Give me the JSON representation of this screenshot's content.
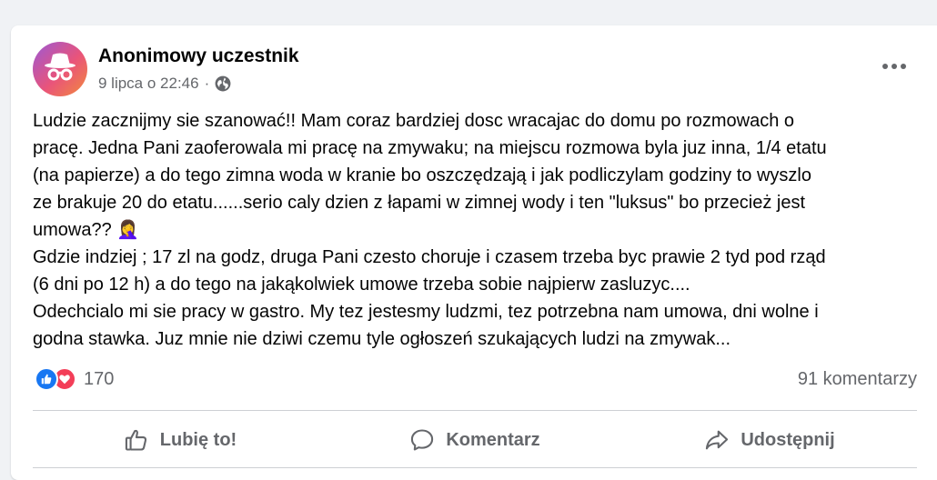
{
  "post": {
    "author": "Anonimowy uczestnik",
    "date": "9 lipca o 22:46",
    "separator": "·",
    "icons": {
      "avatar": "incognito-avatar-icon",
      "privacy": "globe-icon",
      "more": "more-options-icon"
    },
    "avatar_gradient": [
      "#9b59d6",
      "#e9547a",
      "#f28a3c"
    ],
    "text_lines": [
      "Ludzie zacznijmy sie szanować!!  Mam coraz bardziej dosc wracajac do domu po rozmowach o",
      "pracę. Jedna Pani zaoferowala mi pracę na zmywaku; na miejscu rozmowa byla juz inna, 1/4 etatu",
      "(na papierze)  a do tego zimna woda w kranie bo oszczędzają i jak podliczylam godziny to wyszlo",
      "ze brakuje 20 do etatu......serio caly dzien z łapami w zimnej wody i ten \"luksus\" bo przecież jest",
      "umowa?? 🤦‍♀️",
      "Gdzie indziej ; 17 zl na godz, druga Pani czesto choruje i czasem trzeba byc prawie  2 tyd pod rząd",
      "(6 dni po 12 h) a do tego na jakąkolwiek umowe trzeba sobie najpierw zasluzyc....",
      "Odechcialo mi sie pracy w gastro. My tez jestesmy ludzmi, tez potrzebna nam umowa, dni wolne i",
      "godna stawka. Juz mnie nie dziwi czemu tyle ogłoszeń szukających ludzi na zmywak..."
    ]
  },
  "stats": {
    "reaction_count": "170",
    "comments": "91 komentarzy",
    "reaction_icons": [
      "like-reaction-icon",
      "love-reaction-icon"
    ],
    "colors": {
      "like": "#1877f2",
      "love": "#f33e58"
    }
  },
  "actions": {
    "like": "Lubię to!",
    "comment": "Komentarz",
    "share": "Udostępnij"
  }
}
